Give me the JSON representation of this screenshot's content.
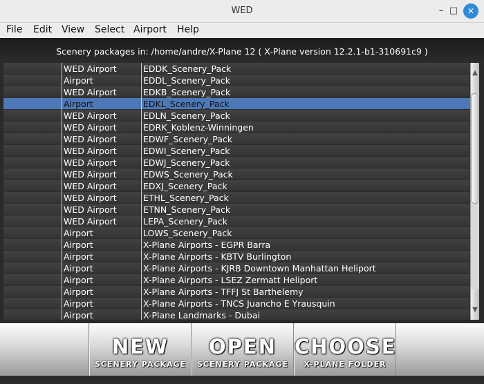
{
  "window": {
    "title": "WED",
    "min_icon": "–",
    "max_icon": "□",
    "close_icon": "✕"
  },
  "menu": [
    "File",
    "Edit",
    "View",
    "Select",
    "Airport",
    "Help"
  ],
  "header": {
    "path_text": "Scenery packages in: /home/andre/X-Plane 12  ( X-Plane version 12.2.1-b1-310691c9 )"
  },
  "rows": [
    [
      "WED Airport",
      "EDDK_Scenery_Pack"
    ],
    [
      "Airport",
      "EDDL_Scenery_Pack"
    ],
    [
      "WED Airport",
      "EDKB_Scenery_Pack"
    ],
    [
      "Airport",
      "EDKL_Scenery_Pack"
    ],
    [
      "WED Airport",
      "EDLN_Scenery_Pack"
    ],
    [
      "WED Airport",
      "EDRK_Koblenz-Winningen"
    ],
    [
      "WED Airport",
      "EDWF_Scenery_Pack"
    ],
    [
      "WED Airport",
      "EDWI_Scenery_Pack"
    ],
    [
      "WED Airport",
      "EDWJ_Scenery_Pack"
    ],
    [
      "WED Airport",
      "EDWS_Scenery_Pack"
    ],
    [
      "WED Airport",
      "EDXJ_Scenery_Pack"
    ],
    [
      "WED Airport",
      "ETHL_Scenery_Pack"
    ],
    [
      "WED Airport",
      "ETNN_Scenery_Pack"
    ],
    [
      "WED Airport",
      "LEPA_Scenery_Pack"
    ],
    [
      "Airport",
      "LOWS_Scenery_Pack"
    ],
    [
      "Airport",
      "X-Plane Airports - EGPR Barra"
    ],
    [
      "Airport",
      "X-Plane Airports - KBTV Burlington"
    ],
    [
      "Airport",
      "X-Plane Airports - KJRB Downtown Manhattan Heliport"
    ],
    [
      "Airport",
      "X-Plane Airports - LSEZ Zermatt Heliport"
    ],
    [
      "Airport",
      "X-Plane Airports - TFFJ St Barthelemy"
    ],
    [
      "Airport",
      "X-Plane Airports - TNCS Juancho E Yrausquin"
    ],
    [
      "Airport",
      "X-Plane Landmarks - Dubai"
    ]
  ],
  "selected_row": 3,
  "scroll": {
    "up_icon": "▲",
    "down_icon": "▼"
  },
  "buttons": {
    "new": {
      "title": "NEW",
      "sub": "SCENERY PACKAGE"
    },
    "open": {
      "title": "OPEN",
      "sub": "SCENERY PACKAGE"
    },
    "choose": {
      "title": "CHOOSE",
      "sub": "X-PLANE FOLDER"
    }
  },
  "colors": {
    "selection": "#4d78b8",
    "close_button": "#2f8ad8"
  }
}
